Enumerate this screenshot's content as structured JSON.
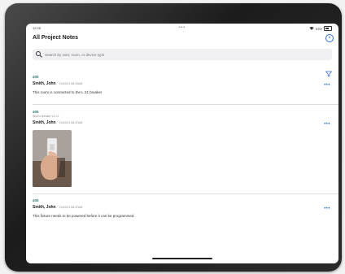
{
  "status_bar": {
    "time": "12:25",
    "dots": "•••",
    "battery": "53%"
  },
  "header": {
    "title": "All Project Notes",
    "close_icon": "close-circle-icon"
  },
  "search": {
    "placeholder": "Search by user, room, or device type"
  },
  "filter_icon": "filter-icon",
  "notes": [
    {
      "room": "405",
      "subtitle": "",
      "author": "Smith, John",
      "time": "10/19/21 08:34AM",
      "text": "This room is connected to the L 21 breaker",
      "has_photo": false
    },
    {
      "room": "405",
      "subtitle": "Wiz2u breaker v4.C1",
      "author": "Smith, John",
      "time": "10/19/21 08:37AM",
      "text": "",
      "has_photo": true
    },
    {
      "room": "405",
      "subtitle": "",
      "author": "Smith, John",
      "time": "10/19/21 08:37AM",
      "text": "This fixture needs to be powered before it can be programmed.",
      "has_photo": false
    }
  ],
  "more_label": "•••",
  "colors": {
    "accent": "#2d6ad8",
    "room": "#2d7a6b"
  }
}
